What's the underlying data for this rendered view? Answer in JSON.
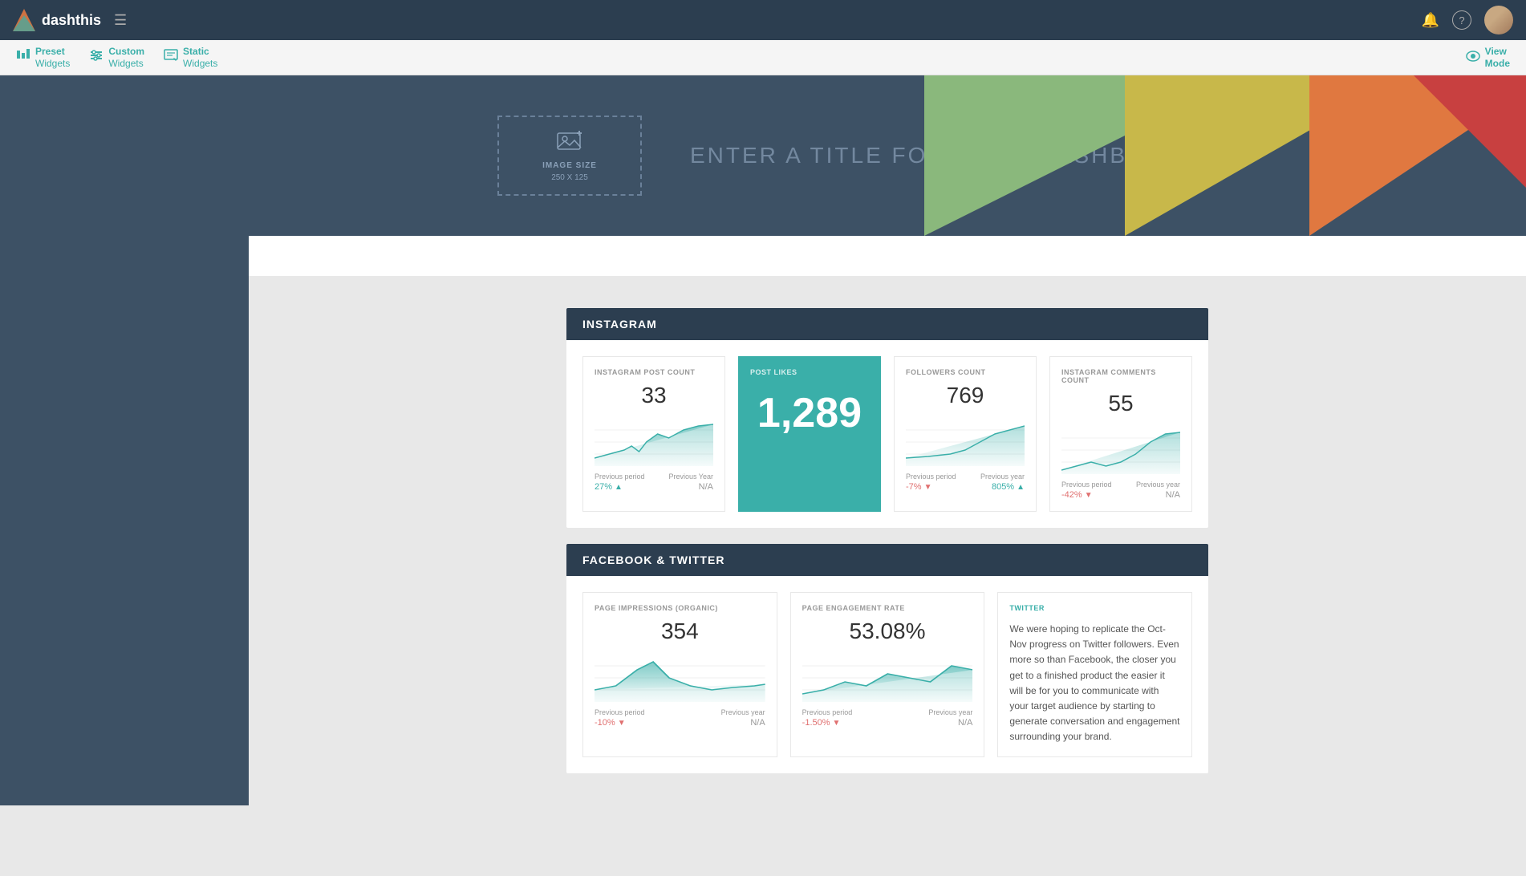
{
  "app": {
    "name": "dashthis",
    "logo_alt": "DashThis Logo"
  },
  "top_nav": {
    "hamburger": "☰",
    "bell_icon": "🔔",
    "help_icon": "?",
    "view_mode_label": "View\nMode"
  },
  "toolbar": {
    "preset_line1": "Preset",
    "preset_line2": "Widgets",
    "custom_line1": "Custom",
    "custom_line2": "Widgets",
    "static_line1": "Static",
    "static_line2": "Widgets",
    "view_mode": "View\nMode"
  },
  "header": {
    "image_size_label": "IMAGE SIZE",
    "image_size_value": "250 X 125",
    "dashboard_title_placeholder": "ENTER A TITLE FOR YOUR DASHBOARD"
  },
  "instagram_section": {
    "title": "INSTAGRAM",
    "widgets": [
      {
        "id": "post-count",
        "label": "INSTAGRAM POST COUNT",
        "value": "33",
        "highlighted": false,
        "prev_period_label": "Previous period",
        "prev_year_label": "Previous Year",
        "prev_period_value": "27%",
        "prev_period_dir": "up",
        "prev_year_value": "N/A",
        "prev_year_dir": "neutral"
      },
      {
        "id": "post-likes",
        "label": "POST LIKES",
        "value": "1,289",
        "highlighted": true,
        "prev_period_label": "",
        "prev_year_label": "",
        "prev_period_value": "",
        "prev_year_value": ""
      },
      {
        "id": "followers-count",
        "label": "FOLLOWERS COUNT",
        "value": "769",
        "highlighted": false,
        "prev_period_label": "Previous period",
        "prev_year_label": "Previous year",
        "prev_period_value": "-7%",
        "prev_period_dir": "down",
        "prev_year_value": "805%",
        "prev_year_dir": "up"
      },
      {
        "id": "comments-count",
        "label": "INSTAGRAM COMMENTS COUNT",
        "value": "55",
        "highlighted": false,
        "prev_period_label": "Previous period",
        "prev_year_label": "Previous year",
        "prev_period_value": "-42%",
        "prev_period_dir": "down",
        "prev_year_value": "N/A",
        "prev_year_dir": "neutral"
      }
    ]
  },
  "facebook_section": {
    "title": "FACEBOOK & TWITTER",
    "widgets": [
      {
        "id": "page-impressions",
        "label": "PAGE IMPRESSIONS (ORGANIC)",
        "value": "354",
        "prev_period_label": "Previous period",
        "prev_year_label": "Previous year",
        "prev_period_value": "-10%",
        "prev_period_dir": "down",
        "prev_year_value": "N/A",
        "prev_year_dir": "neutral"
      },
      {
        "id": "engagement-rate",
        "label": "PAGE ENGAGEMENT RATE",
        "value": "53.08%",
        "prev_period_label": "Previous period",
        "prev_year_label": "Previous year",
        "prev_period_value": "-1.50%",
        "prev_period_dir": "down",
        "prev_year_value": "N/A",
        "prev_year_dir": "neutral"
      }
    ],
    "twitter": {
      "label": "TWITTER",
      "text": "We were hoping to replicate the Oct-Nov progress on Twitter followers. Even more so than Facebook, the closer you get to a finished product the easier it will be for you to communicate with your target audience by starting to generate conversation and engagement surrounding your brand."
    }
  }
}
